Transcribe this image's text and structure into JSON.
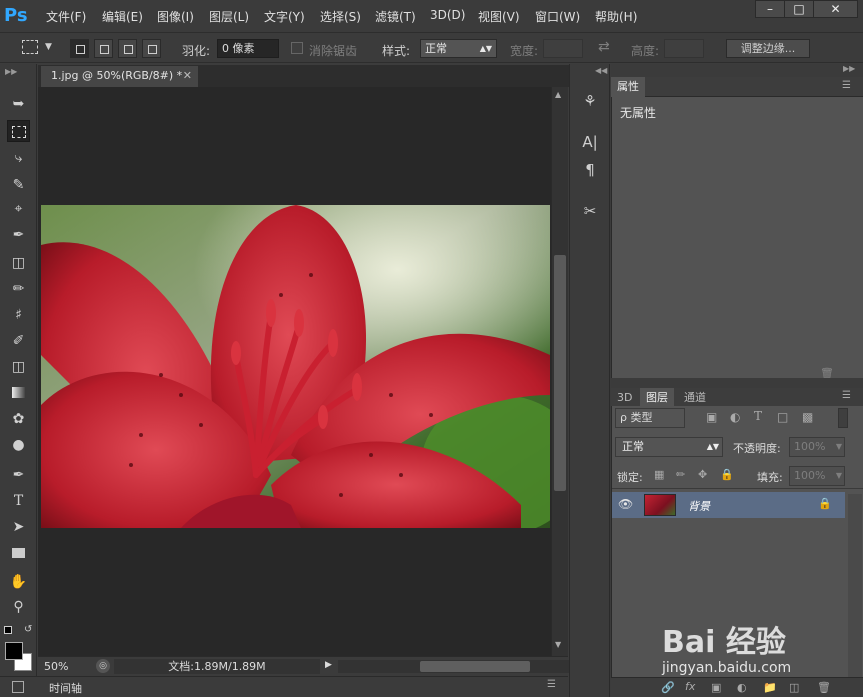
{
  "app": {
    "logo": "Ps"
  },
  "menu": [
    {
      "label": "文件(F)"
    },
    {
      "label": "编辑(E)"
    },
    {
      "label": "图像(I)"
    },
    {
      "label": "图层(L)"
    },
    {
      "label": "文字(Y)"
    },
    {
      "label": "选择(S)"
    },
    {
      "label": "滤镜(T)"
    },
    {
      "label": "3D(D)"
    },
    {
      "label": "视图(V)"
    },
    {
      "label": "窗口(W)"
    },
    {
      "label": "帮助(H)"
    }
  ],
  "options": {
    "feather_label": "羽化:",
    "feather_value": "0 像素",
    "antialias_label": "消除锯齿",
    "style_label": "样式:",
    "style_value": "正常",
    "width_label": "宽度:",
    "height_label": "高度:",
    "refine_edge": "调整边缘..."
  },
  "document": {
    "tab_title": "1.jpg @ 50%(RGB/8#) *",
    "zoom": "50%",
    "doc_info": "文档:1.89M/1.89M"
  },
  "timeline": {
    "label": "时间轴"
  },
  "properties": {
    "tab": "属性",
    "content": "无属性"
  },
  "layers": {
    "tabs": [
      "3D",
      "图层",
      "通道"
    ],
    "filter_kind": "ρ 类型",
    "blend_mode": "正常",
    "opacity_label": "不透明度:",
    "opacity_value": "100%",
    "lock_label": "锁定:",
    "fill_label": "填充:",
    "fill_value": "100%",
    "layer_name": "背景"
  },
  "watermark": {
    "brand": "Bai 经验",
    "url": "jingyan.baidu.com"
  },
  "icons": {
    "menu_win": [
      "minimize-icon",
      "maximize-icon",
      "close-icon"
    ]
  }
}
